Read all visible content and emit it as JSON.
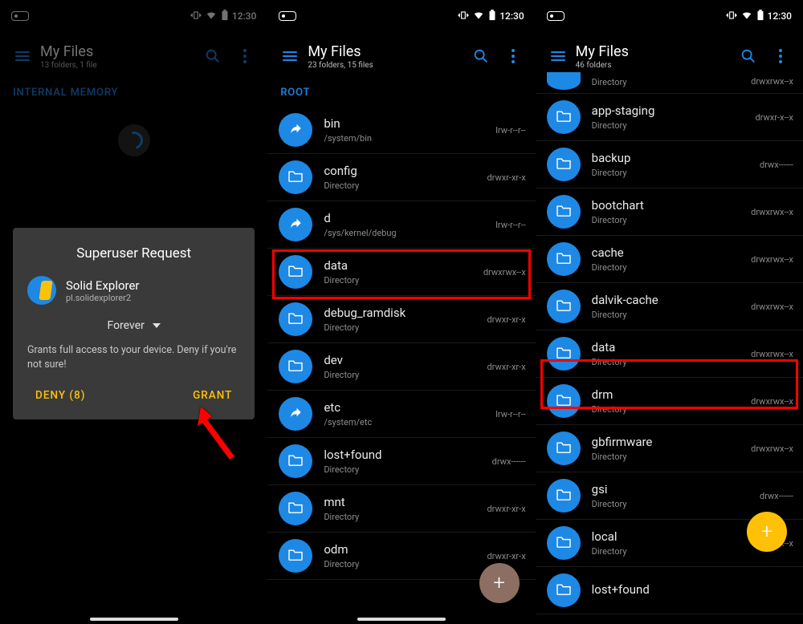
{
  "colors": {
    "accent": "#1E88E5",
    "fab_amber": "#FFC107",
    "fab_brown": "#8D6E63",
    "highlight": "#ff0000"
  },
  "status": {
    "time": "12:30"
  },
  "panel1": {
    "title": "My Files",
    "subtitle": "13 folders, 1 file",
    "tab": "INTERNAL MEMORY"
  },
  "dialog": {
    "title": "Superuser Request",
    "app_name": "Solid Explorer",
    "app_package": "pl.solidexplorer2",
    "duration": "Forever",
    "warning": "Grants full access to your device. Deny if you're not sure!",
    "deny": "DENY (8)",
    "grant": "GRANT"
  },
  "panel2": {
    "title": "My Files",
    "subtitle": "23 folders, 15 files",
    "tab": "ROOT",
    "highlight_index": 3,
    "fab_color": "#8D6E63",
    "items": [
      {
        "icon": "share",
        "name": "bin",
        "sub": "/system/bin",
        "perm": "lrw-r--r--"
      },
      {
        "icon": "folder",
        "name": "config",
        "sub": "Directory",
        "perm": "drwxr-xr-x"
      },
      {
        "icon": "share",
        "name": "d",
        "sub": "/sys/kernel/debug",
        "perm": "lrw-r--r--"
      },
      {
        "icon": "folder",
        "name": "data",
        "sub": "Directory",
        "perm": "drwxrwx--x"
      },
      {
        "icon": "folder",
        "name": "debug_ramdisk",
        "sub": "Directory",
        "perm": "drwxr-xr-x"
      },
      {
        "icon": "folder",
        "name": "dev",
        "sub": "Directory",
        "perm": "drwxr-xr-x"
      },
      {
        "icon": "share",
        "name": "etc",
        "sub": "/system/etc",
        "perm": "lrw-r--r--"
      },
      {
        "icon": "folder",
        "name": "lost+found",
        "sub": "Directory",
        "perm": "drwx------"
      },
      {
        "icon": "folder",
        "name": "mnt",
        "sub": "Directory",
        "perm": "drwxr-xr-x"
      },
      {
        "icon": "folder",
        "name": "odm",
        "sub": "Directory",
        "perm": "drwxr-xr-x"
      }
    ]
  },
  "panel3": {
    "title": "My Files",
    "subtitle": "46 folders",
    "highlight_index": 6,
    "fab_color": "#FFC107",
    "items": [
      {
        "icon": "folder",
        "name": "",
        "sub": "Directory",
        "perm": "drwxrwx--x"
      },
      {
        "icon": "folder",
        "name": "app-staging",
        "sub": "Directory",
        "perm": "drwxr-x--x"
      },
      {
        "icon": "folder",
        "name": "backup",
        "sub": "Directory",
        "perm": "drwx------"
      },
      {
        "icon": "folder",
        "name": "bootchart",
        "sub": "Directory",
        "perm": "drwxrwx--x"
      },
      {
        "icon": "folder",
        "name": "cache",
        "sub": "Directory",
        "perm": "drwxrwx--x"
      },
      {
        "icon": "folder",
        "name": "dalvik-cache",
        "sub": "Directory",
        "perm": "drwxrwx--x"
      },
      {
        "icon": "folder",
        "name": "data",
        "sub": "Directory",
        "perm": "drwxrwx--x"
      },
      {
        "icon": "folder",
        "name": "drm",
        "sub": "Directory",
        "perm": "drwxrwx--x"
      },
      {
        "icon": "folder",
        "name": "gbfirmware",
        "sub": "Directory",
        "perm": "drwxrwx--x"
      },
      {
        "icon": "folder",
        "name": "gsi",
        "sub": "Directory",
        "perm": "drwx------"
      },
      {
        "icon": "folder",
        "name": "local",
        "sub": "Directory",
        "perm": "drwxr-x--x"
      },
      {
        "icon": "folder",
        "name": "lost+found",
        "sub": "",
        "perm": ""
      }
    ]
  }
}
